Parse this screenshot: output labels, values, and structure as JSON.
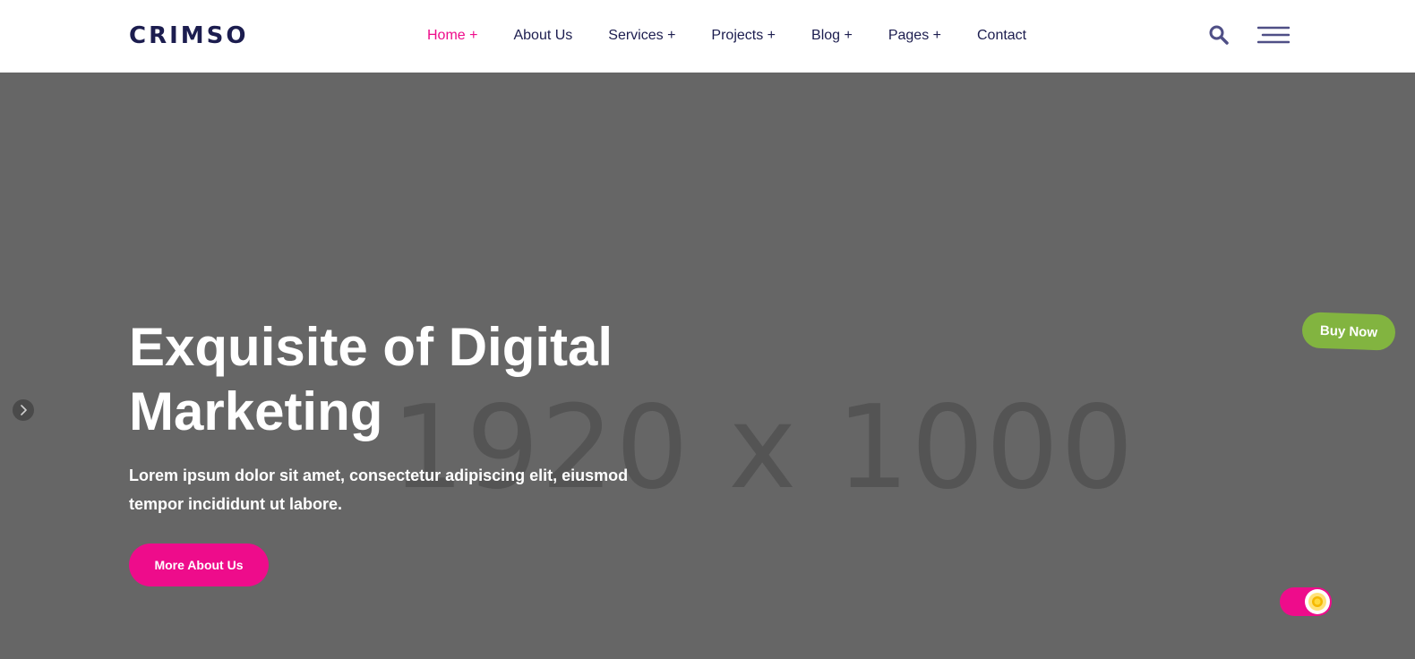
{
  "brand": {
    "logo_text": "CRIMSO"
  },
  "nav": {
    "items": [
      {
        "label": "Home +",
        "active": true
      },
      {
        "label": "About Us",
        "active": false
      },
      {
        "label": "Services +",
        "active": false
      },
      {
        "label": "Projects +",
        "active": false
      },
      {
        "label": "Blog +",
        "active": false
      },
      {
        "label": "Pages +",
        "active": false
      },
      {
        "label": "Contact",
        "active": false
      }
    ]
  },
  "header_icons": {
    "search": "search-icon",
    "menu": "hamburger-menu-icon"
  },
  "hero": {
    "placeholder_text": "1920 x 1000",
    "title_line1": "Exquisite of Digital",
    "title_line2": "Marketing",
    "description_line1": "Lorem ipsum dolor sit amet, consectetur adipiscing elit, eiusmod",
    "description_line2": "tempor incididunt ut labore.",
    "button_label": "More About Us"
  },
  "floating": {
    "buy_now_label": "Buy Now",
    "theme_toggle": "sun-icon"
  },
  "colors": {
    "accent": "#ee0c8b",
    "brand_dark": "#1c1d4f",
    "buy_now": "#82b440",
    "hero_bg": "#666666",
    "icon": "#4f4f86"
  }
}
